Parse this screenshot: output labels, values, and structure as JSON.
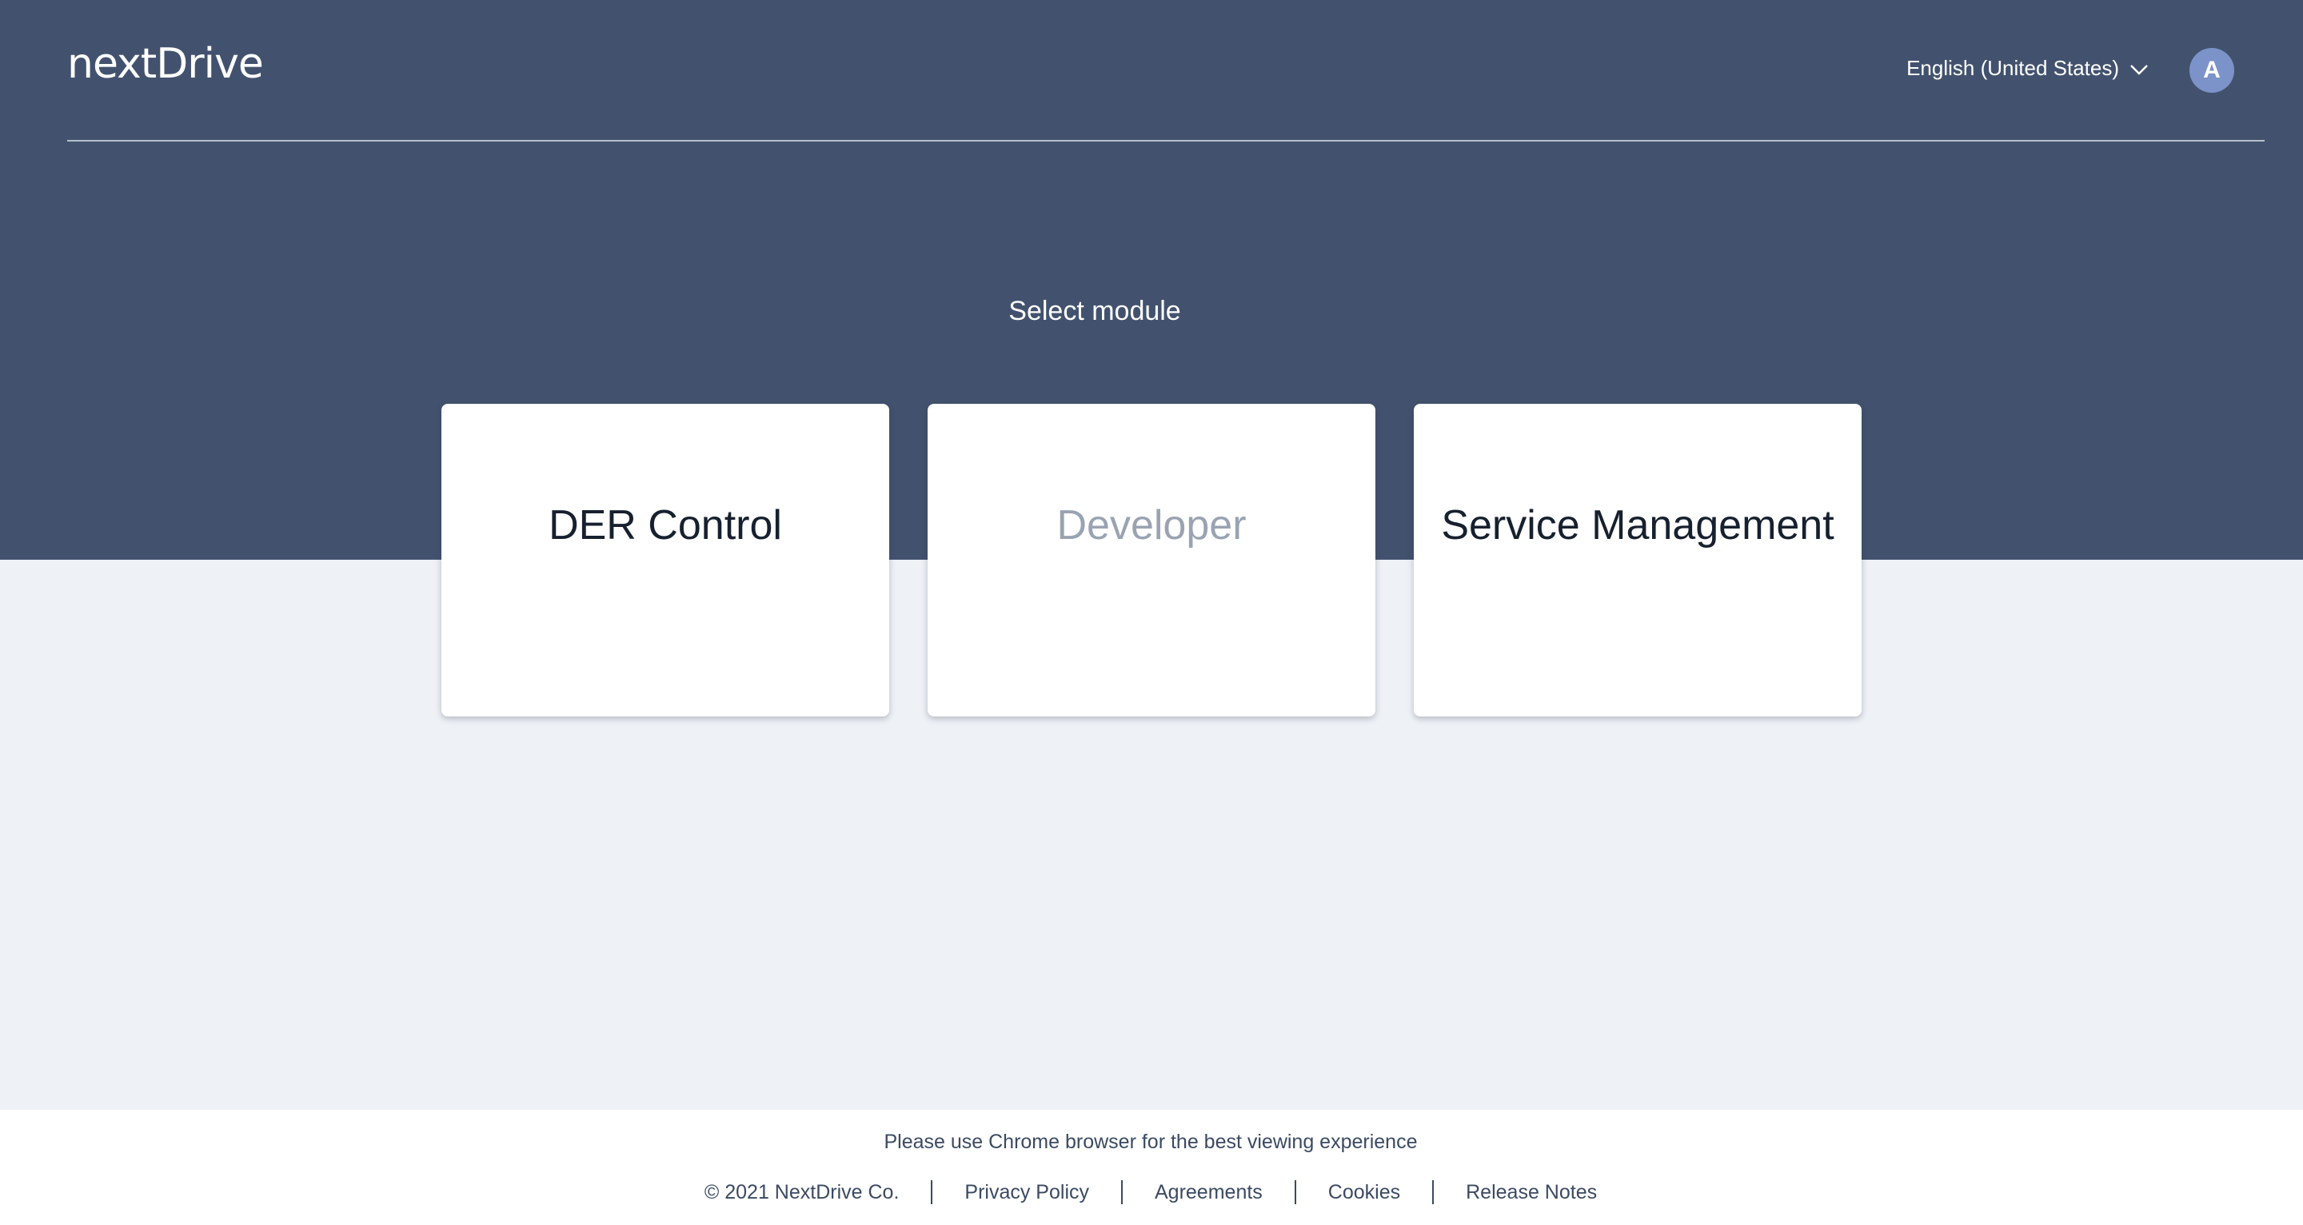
{
  "header": {
    "logo_text": "nextDrive",
    "language_label": "English (United States)",
    "avatar_initial": "A"
  },
  "main": {
    "title": "Select module",
    "modules": [
      {
        "label": "DER Control",
        "enabled": true
      },
      {
        "label": "Developer",
        "enabled": false
      },
      {
        "label": "Service Management",
        "enabled": true
      }
    ]
  },
  "footer": {
    "note": "Please use Chrome browser for the best viewing experience",
    "copyright": "© 2021 NextDrive Co.",
    "links": [
      "Privacy Policy",
      "Agreements",
      "Cookies",
      "Release Notes"
    ]
  },
  "colors": {
    "hero_bg": "#42526e",
    "page_bg": "#eef1f6",
    "avatar_bg": "#7b93c9",
    "disabled_text": "#9aa3b2"
  },
  "icons": {
    "language_dropdown": "chevron-down-icon"
  }
}
